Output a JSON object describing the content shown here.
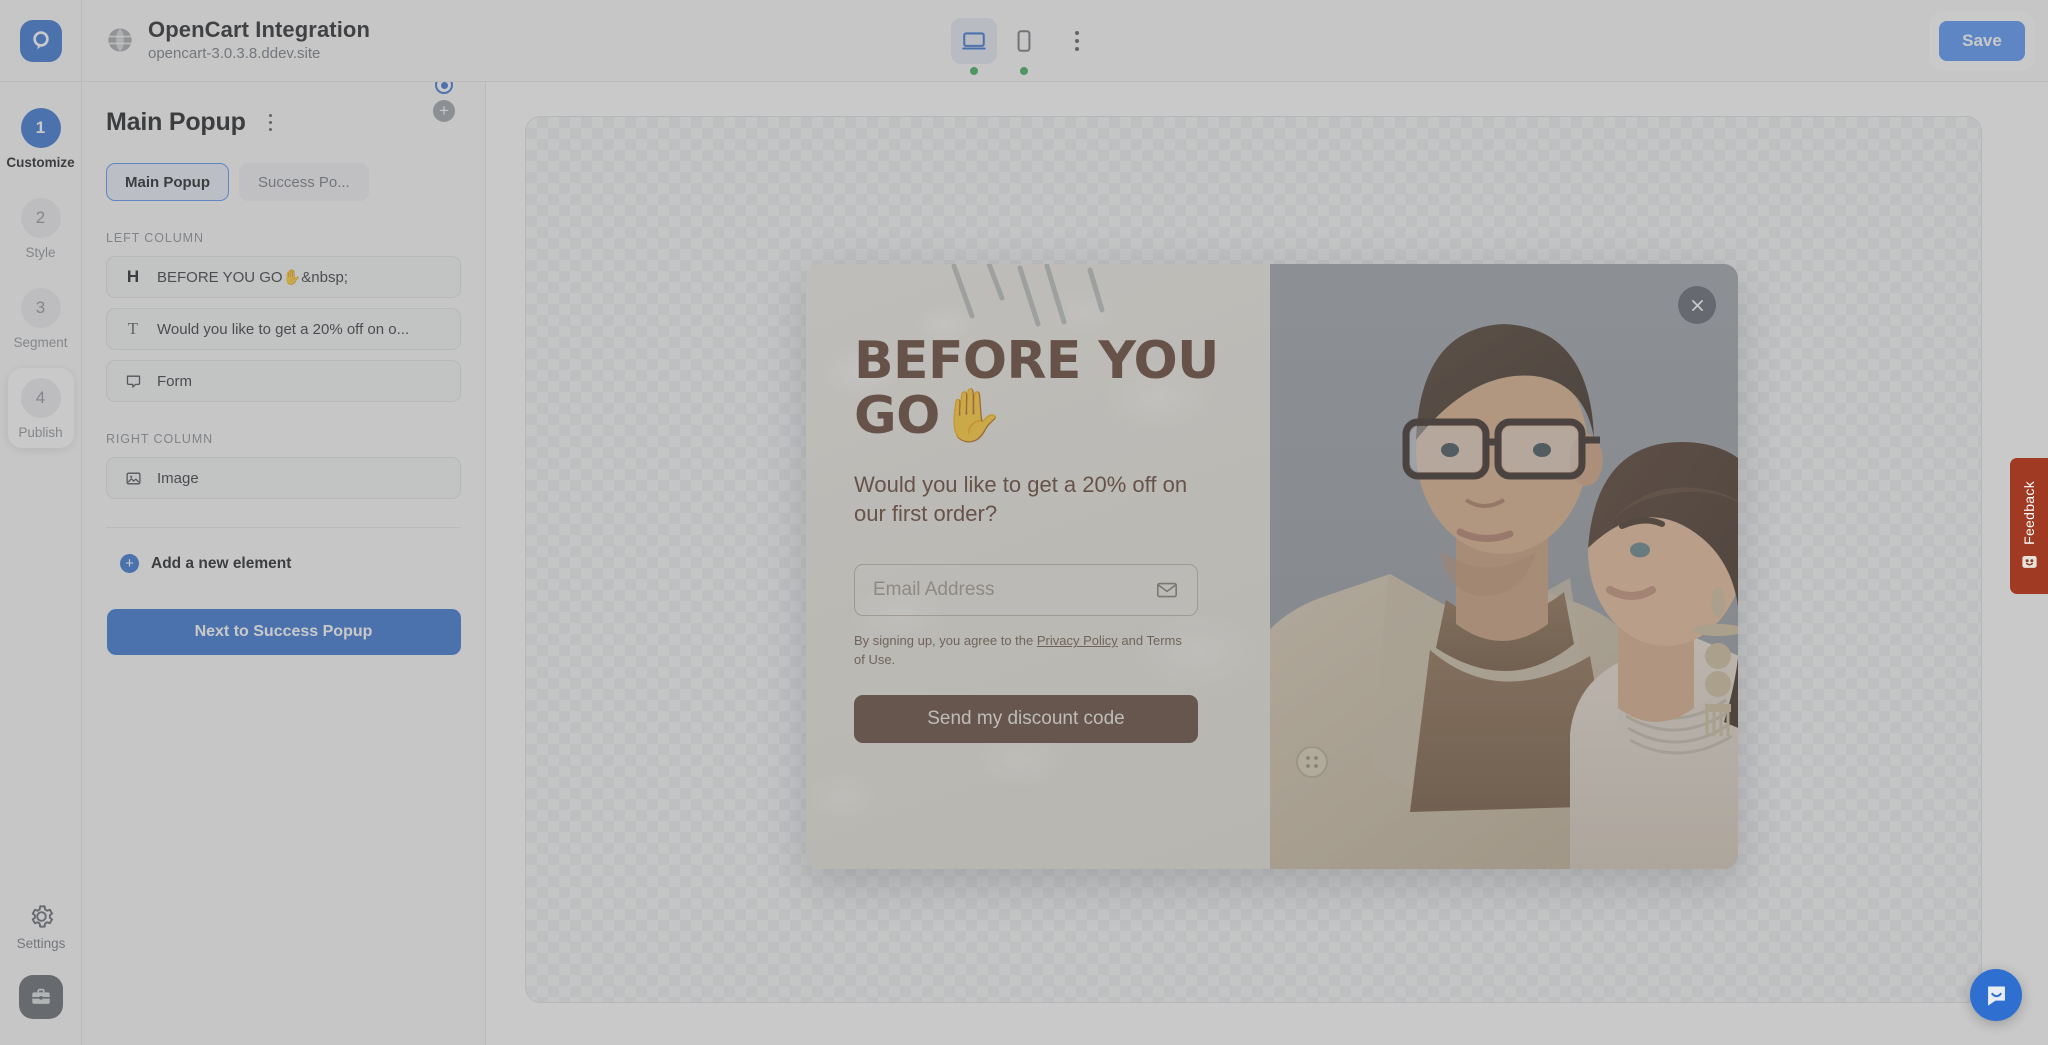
{
  "header": {
    "logo_icon": "optimonk-logo-icon",
    "globe_icon": "globe-icon",
    "site_title": "OpenCart Integration",
    "site_url": "opencart-3.0.3.8.ddev.site",
    "devices": [
      {
        "icon": "desktop-icon",
        "name": "desktop",
        "active": true,
        "status": "online"
      },
      {
        "icon": "mobile-icon",
        "name": "mobile",
        "active": false,
        "status": "online"
      }
    ],
    "more_icon": "kebab-menu-icon",
    "save_label": "Save"
  },
  "rail": {
    "steps": [
      {
        "number": "1",
        "label": "Customize",
        "state": "active"
      },
      {
        "number": "2",
        "label": "Style",
        "state": "default"
      },
      {
        "number": "3",
        "label": "Segment",
        "state": "default"
      },
      {
        "number": "4",
        "label": "Publish",
        "state": "hovered"
      }
    ],
    "settings_icon": "gear-icon",
    "settings_label": "Settings",
    "briefcase_icon": "briefcase-icon"
  },
  "sidebar": {
    "title": "Main Popup",
    "title_menu_icon": "kebab-menu-icon",
    "target_icon": "radio-target-icon",
    "add_icon": "plus-circle-icon",
    "tabs": [
      {
        "label": "Main Popup",
        "active": true
      },
      {
        "label": "Success Po...",
        "active": false
      }
    ],
    "left_column_label": "LEFT COLUMN",
    "left_column_items": [
      {
        "icon": "heading-icon",
        "glyph": "H",
        "label": "BEFORE YOU GO✋&nbsp;"
      },
      {
        "icon": "text-icon",
        "glyph": "T",
        "label": "Would you like to get a 20% off on o..."
      },
      {
        "icon": "form-icon",
        "glyph": "",
        "label": "Form"
      }
    ],
    "right_column_label": "RIGHT COLUMN",
    "right_column_items": [
      {
        "icon": "image-icon",
        "glyph": "",
        "label": "Image"
      }
    ],
    "add_element_label": "Add a new element",
    "add_element_icon": "plus-circle-icon",
    "next_label": "Next to Success Popup"
  },
  "popup": {
    "headline": "BEFORE YOU GO",
    "headline_emoji": "✋",
    "subheadline": "Would you like to get a 20% off on our first order?",
    "email_placeholder": "Email Address",
    "email_icon": "envelope-icon",
    "legal_prefix": "By signing up, you agree to the ",
    "legal_link": "Privacy Policy",
    "legal_suffix": " and Terms of Use.",
    "cta_label": "Send my discount code",
    "close_icon": "close-icon",
    "image_alt": "couple-fashion-photo",
    "colors": {
      "headline": "#5b3a2a",
      "cta_bg": "#5c4033",
      "panel_bg": "#ece9e2"
    }
  },
  "feedback": {
    "label": "Feedback",
    "icon": "smiley-face-icon",
    "color": "#a03a22"
  },
  "chat": {
    "icon": "chat-bubble-icon",
    "color": "#2f6fd0"
  }
}
